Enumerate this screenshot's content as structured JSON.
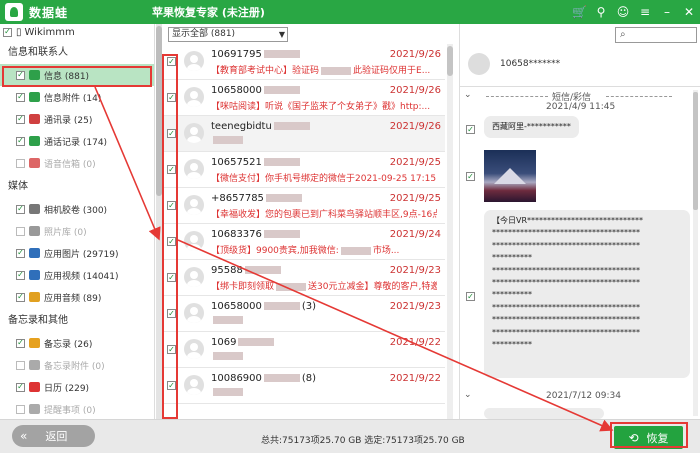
{
  "app": {
    "name": "数据蛙",
    "title": "苹果恢复专家 (未注册)"
  },
  "device": {
    "name": "Wikimmm"
  },
  "sidebar": {
    "sections": [
      {
        "label": "信息和联系人",
        "items": [
          {
            "label": "信息 (881)",
            "checked": true,
            "color": "#2ea04a",
            "selected": true
          },
          {
            "label": "信息附件 (14)",
            "checked": true,
            "color": "#2ea04a"
          },
          {
            "label": "通讯录 (25)",
            "checked": true,
            "color": "#d04040"
          },
          {
            "label": "通话记录 (174)",
            "checked": true,
            "color": "#2ea04a"
          },
          {
            "label": "语音信箱 (0)",
            "checked": false,
            "color": "#d66",
            "disabled": true
          }
        ]
      },
      {
        "label": "媒体",
        "items": [
          {
            "label": "相机胶卷 (300)",
            "checked": true,
            "color": "#777"
          },
          {
            "label": "照片库 (0)",
            "checked": false,
            "color": "#999",
            "disabled": true
          },
          {
            "label": "应用图片 (29719)",
            "checked": true,
            "color": "#2f6fba"
          },
          {
            "label": "应用视频 (14041)",
            "checked": true,
            "color": "#2f6fba"
          },
          {
            "label": "应用音频 (89)",
            "checked": true,
            "color": "#e1a020"
          }
        ]
      },
      {
        "label": "备忘录和其他",
        "items": [
          {
            "label": "备忘录 (26)",
            "checked": true,
            "color": "#e6a11f"
          },
          {
            "label": "备忘录附件 (0)",
            "checked": false,
            "color": "#aaa",
            "disabled": true
          },
          {
            "label": "日历 (229)",
            "checked": true,
            "color": "#d33"
          },
          {
            "label": "提醒事项 (0)",
            "checked": false,
            "color": "#aaa",
            "disabled": true
          }
        ]
      }
    ]
  },
  "filter": {
    "selected": "显示全部 (881)"
  },
  "messages": [
    {
      "name": "10691795",
      "date": "2021/9/26",
      "preview": "【教育部考试中心】验证码",
      "preview2": "此验证码仅用于E..."
    },
    {
      "name": "10658000",
      "date": "2021/9/26",
      "preview": "【咪咕阅读】听说《国子监来了个女弟子》戳》http:..."
    },
    {
      "name": "teenegbidtu",
      "date": "2021/9/26",
      "preview": "",
      "preview2": ""
    },
    {
      "name": "10657521",
      "date": "2021/9/25",
      "preview": "【微信支付】你手机号绑定的微信于2021-09-25 17:15..."
    },
    {
      "name": "+8657785",
      "date": "2021/9/25",
      "preview": "【幸福收发】您的包裹已到广科菜鸟驿站顺丰区,9点-16点..."
    },
    {
      "name": "10683376",
      "date": "2021/9/24",
      "preview": "【顶级货】9900贵宾,加我微信:",
      "preview2": "市场..."
    },
    {
      "name": "95588",
      "date": "2021/9/23",
      "preview": "【绑卡即刻领取",
      "preview2": "送30元立减金】尊敬的客户,特邀您参加..."
    },
    {
      "name": "10658000",
      "count": "(3)",
      "date": "2021/9/23",
      "preview": "",
      "preview2": ""
    },
    {
      "name": "1069",
      "date": "2021/9/22",
      "preview": "",
      "preview2": ""
    },
    {
      "name": "10086900",
      "count": "(8)",
      "date": "2021/9/22",
      "preview": "",
      "preview2": ""
    }
  ],
  "detail": {
    "contact": "10658*******",
    "search_placeholder": "",
    "group1": "短信/彩信",
    "time1": "2021/4/9 11:45",
    "bubble1": "西藏阿里-***********",
    "bubble2": "【今日VR*****************************\n*************************************\n*************************************\n**********\n*************************************\n*************************************\n**********\n*************************************\n*************************************\n*************************************\n**********",
    "time2": "2021/7/12 09:34"
  },
  "footer": {
    "back": "返回",
    "total": "总共:75173项25.70 GB 选定:75173项25.70 GB",
    "recover": "恢复"
  },
  "colors": {
    "accent": "#29a744",
    "selected_row": "#b9e4c3",
    "annotation": "#e53935"
  }
}
